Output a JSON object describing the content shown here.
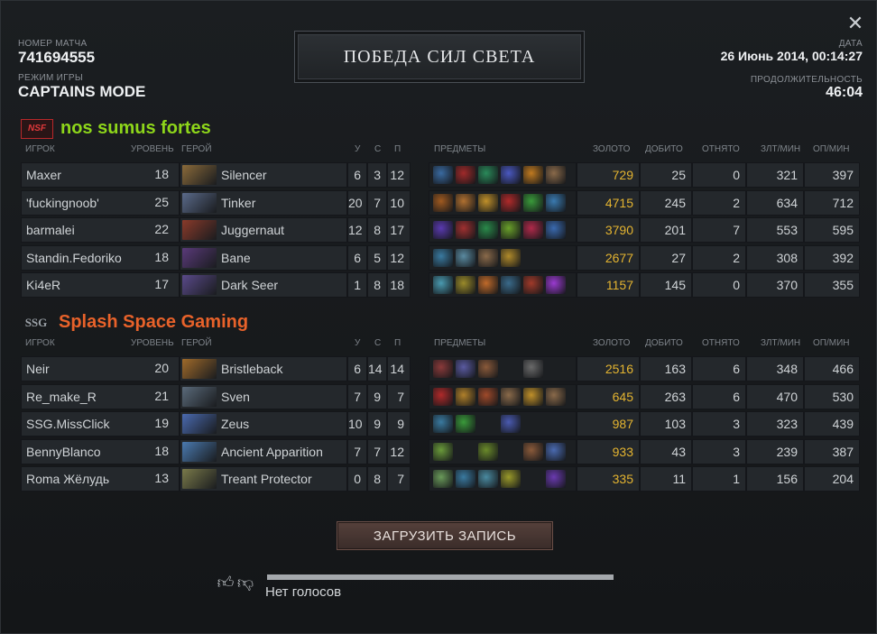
{
  "header": {
    "match_label": "НОМЕР МАТЧА",
    "match_id": "741694555",
    "mode_label": "РЕЖИМ ИГРЫ",
    "mode": "CAPTAINS MODE",
    "result": "ПОБЕДА СИЛ СВЕТА",
    "date_label": "ДАТА",
    "date": "26 Июнь 2014, 00:14:27",
    "duration_label": "ПРОДОЛЖИТЕЛЬНОСТЬ",
    "duration": "46:04",
    "close_icon": "close-icon"
  },
  "columns": {
    "player": "ИГРОК",
    "level": "УРОВЕНЬ",
    "hero": "ГЕРОЙ",
    "k": "У",
    "d": "С",
    "a": "П",
    "items": "ПРЕДМЕТЫ",
    "gold": "ЗОЛОТО",
    "lh": "ДОБИТО",
    "dn": "ОТНЯТО",
    "gpm": "ЗЛТ/МИН",
    "xpm": "ОП/МИН"
  },
  "teams": [
    {
      "name": "nos sumus fortes",
      "logo_text": "NSF",
      "color": "#8ed61a",
      "players": [
        {
          "player": "Maxer",
          "level": "18",
          "hero": "Silencer",
          "k": "6",
          "d": "3",
          "a": "12",
          "gold": "729",
          "lh": "25",
          "dn": "0",
          "gpm": "321",
          "xpm": "397",
          "hero_color": "#8a6a3a",
          "items": [
            "#3a6aa0",
            "#a02a2a",
            "#2a8a5a",
            "#4a58c0",
            "#c07a20",
            "#8a6a4a"
          ]
        },
        {
          "player": "'fuckingnoob'",
          "level": "25",
          "hero": "Tinker",
          "k": "20",
          "d": "7",
          "a": "10",
          "gold": "4715",
          "lh": "245",
          "dn": "2",
          "gpm": "634",
          "xpm": "712",
          "hero_color": "#5a6a8a",
          "items": [
            "#a05a20",
            "#b07030",
            "#c0902a",
            "#b02a2a",
            "#3a9a3a",
            "#3a7ab0"
          ]
        },
        {
          "player": "barmalei",
          "level": "22",
          "hero": "Juggernaut",
          "k": "12",
          "d": "8",
          "a": "17",
          "gold": "3790",
          "lh": "201",
          "dn": "7",
          "gpm": "553",
          "xpm": "595",
          "hero_color": "#8a3a2a",
          "items": [
            "#5a3ab0",
            "#a03030",
            "#2a8a4a",
            "#6aa02a",
            "#b02a4a",
            "#3a6ab0"
          ]
        },
        {
          "player": "Standin.Fedoriko",
          "level": "18",
          "hero": "Bane",
          "k": "6",
          "d": "5",
          "a": "12",
          "gold": "2677",
          "lh": "27",
          "dn": "2",
          "gpm": "308",
          "xpm": "392",
          "hero_color": "#5a3a7a",
          "items": [
            "#3a7aa0",
            "#5a8aa0",
            "#8a6a4a",
            "#b08a2a"
          ]
        },
        {
          "player": "Ki4eR",
          "level": "17",
          "hero": "Dark Seer",
          "k": "1",
          "d": "8",
          "a": "18",
          "gold": "1157",
          "lh": "145",
          "dn": "0",
          "gpm": "370",
          "xpm": "355",
          "hero_color": "#5a4a8a",
          "items": [
            "#4a9ab0",
            "#9a8a2a",
            "#c06a2a",
            "#3a6a8a",
            "#a03a2a",
            "#9a3ad0"
          ]
        }
      ]
    },
    {
      "name": "Splash Space Gaming",
      "logo_text": "SSG",
      "color": "#e8622a",
      "players": [
        {
          "player": "Neir",
          "level": "20",
          "hero": "Bristleback",
          "k": "6",
          "d": "14",
          "a": "14",
          "gold": "2516",
          "lh": "163",
          "dn": "6",
          "gpm": "348",
          "xpm": "466",
          "hero_color": "#a06a2a",
          "items": [
            "#8a3a3a",
            "#5a5aa0",
            "#8a5a3a",
            "",
            "#6a6a6a"
          ]
        },
        {
          "player": "Re_make_R",
          "level": "21",
          "hero": "Sven",
          "k": "7",
          "d": "9",
          "a": "7",
          "gold": "645",
          "lh": "263",
          "dn": "6",
          "gpm": "470",
          "xpm": "530",
          "hero_color": "#5a6a7a",
          "items": [
            "#b02a2a",
            "#b0802a",
            "#a04a2a",
            "#8a6a4a",
            "#c0902a",
            "#8a6a4a"
          ]
        },
        {
          "player": "SSG.MissClick",
          "level": "19",
          "hero": "Zeus",
          "k": "10",
          "d": "9",
          "a": "9",
          "gold": "987",
          "lh": "103",
          "dn": "3",
          "gpm": "323",
          "xpm": "439",
          "hero_color": "#4a6ab0",
          "items": [
            "#3a7aa0",
            "#3a9a3a",
            "",
            "#4a5ab0"
          ]
        },
        {
          "player": "BennyBlanco",
          "level": "18",
          "hero": "Ancient Apparition",
          "k": "7",
          "d": "7",
          "a": "12",
          "gold": "933",
          "lh": "43",
          "dn": "3",
          "gpm": "239",
          "xpm": "387",
          "hero_color": "#4a7ab0",
          "items": [
            "#6a9a3a",
            "",
            "#6a8a2a",
            "",
            "#8a5a3a",
            "#4a6ab0"
          ]
        },
        {
          "player": "Roma Жёлудь",
          "level": "13",
          "hero": "Treant Protector",
          "k": "0",
          "d": "8",
          "a": "7",
          "gold": "335",
          "lh": "11",
          "dn": "1",
          "gpm": "156",
          "xpm": "204",
          "hero_color": "#7a7a4a",
          "items": [
            "#6a9a5a",
            "#3a7aa0",
            "#4a8aa0",
            "#9a9a2a",
            "",
            "#6a3ab0"
          ]
        }
      ]
    }
  ],
  "actions": {
    "download": "ЗАГРУЗИТЬ ЗАПИСЬ"
  },
  "votes": {
    "up_icon": "thumbs-up-icon",
    "down_icon": "thumbs-down-icon",
    "text": "Нет голосов"
  }
}
